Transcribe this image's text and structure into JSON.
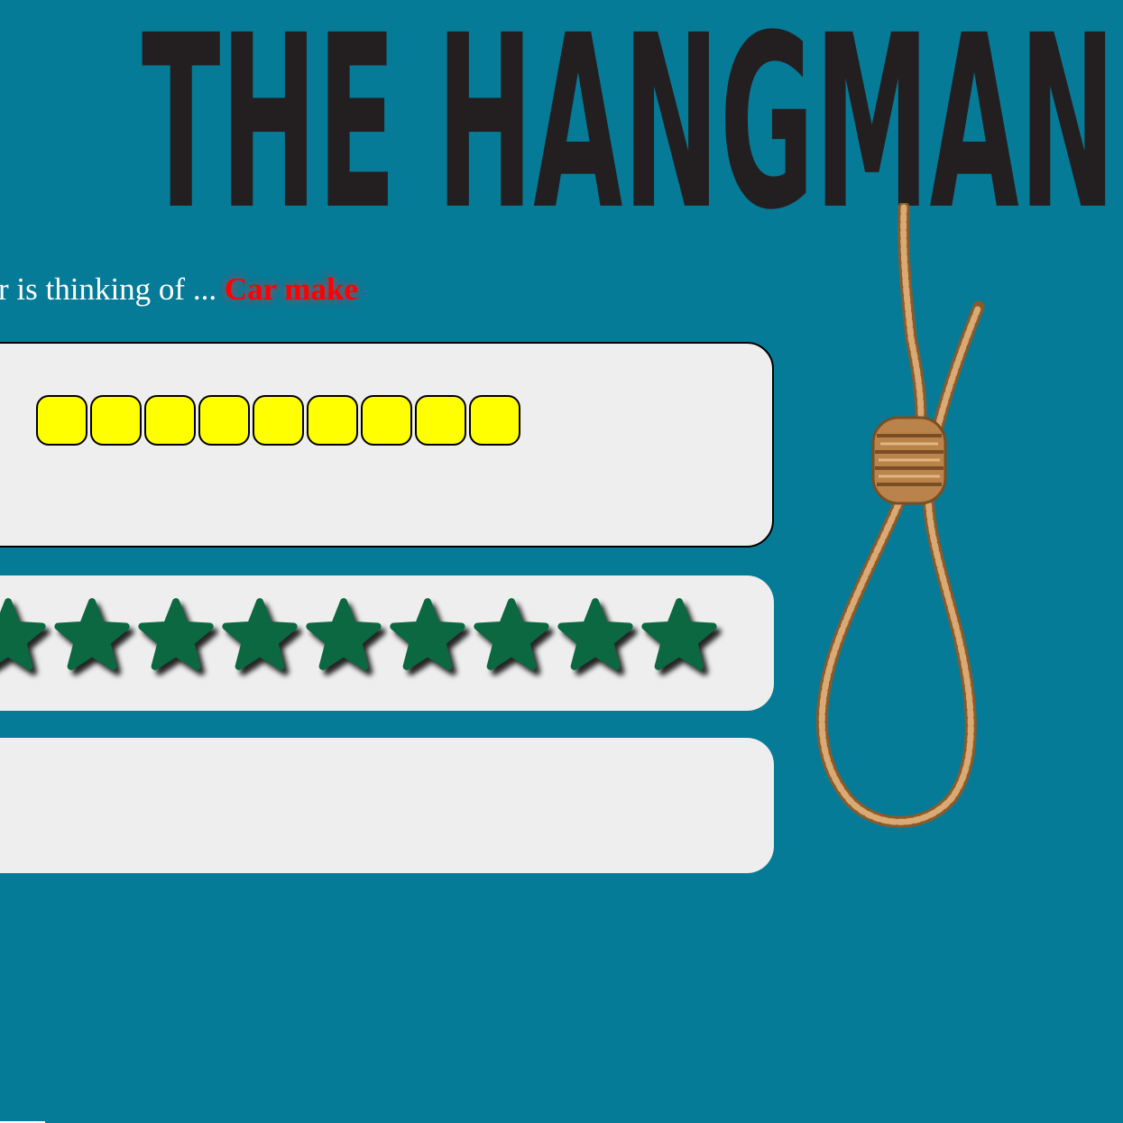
{
  "title": "THE HANGMAN",
  "category": {
    "prompt": "r is thinking of ...",
    "value": "Car make"
  },
  "word": {
    "letters": [
      "",
      "",
      "",
      "",
      "",
      "",
      "",
      "",
      ""
    ]
  },
  "lives": {
    "stars_remaining": 9
  },
  "guessed": {
    "letters": ""
  },
  "colors": {
    "background": "#067b98",
    "panel": "#eeeeee",
    "letter_slot": "#ffff00",
    "star": "#0b6840",
    "category_value": "#ff0000",
    "title": "#231f20",
    "rope": "#c9955c"
  }
}
